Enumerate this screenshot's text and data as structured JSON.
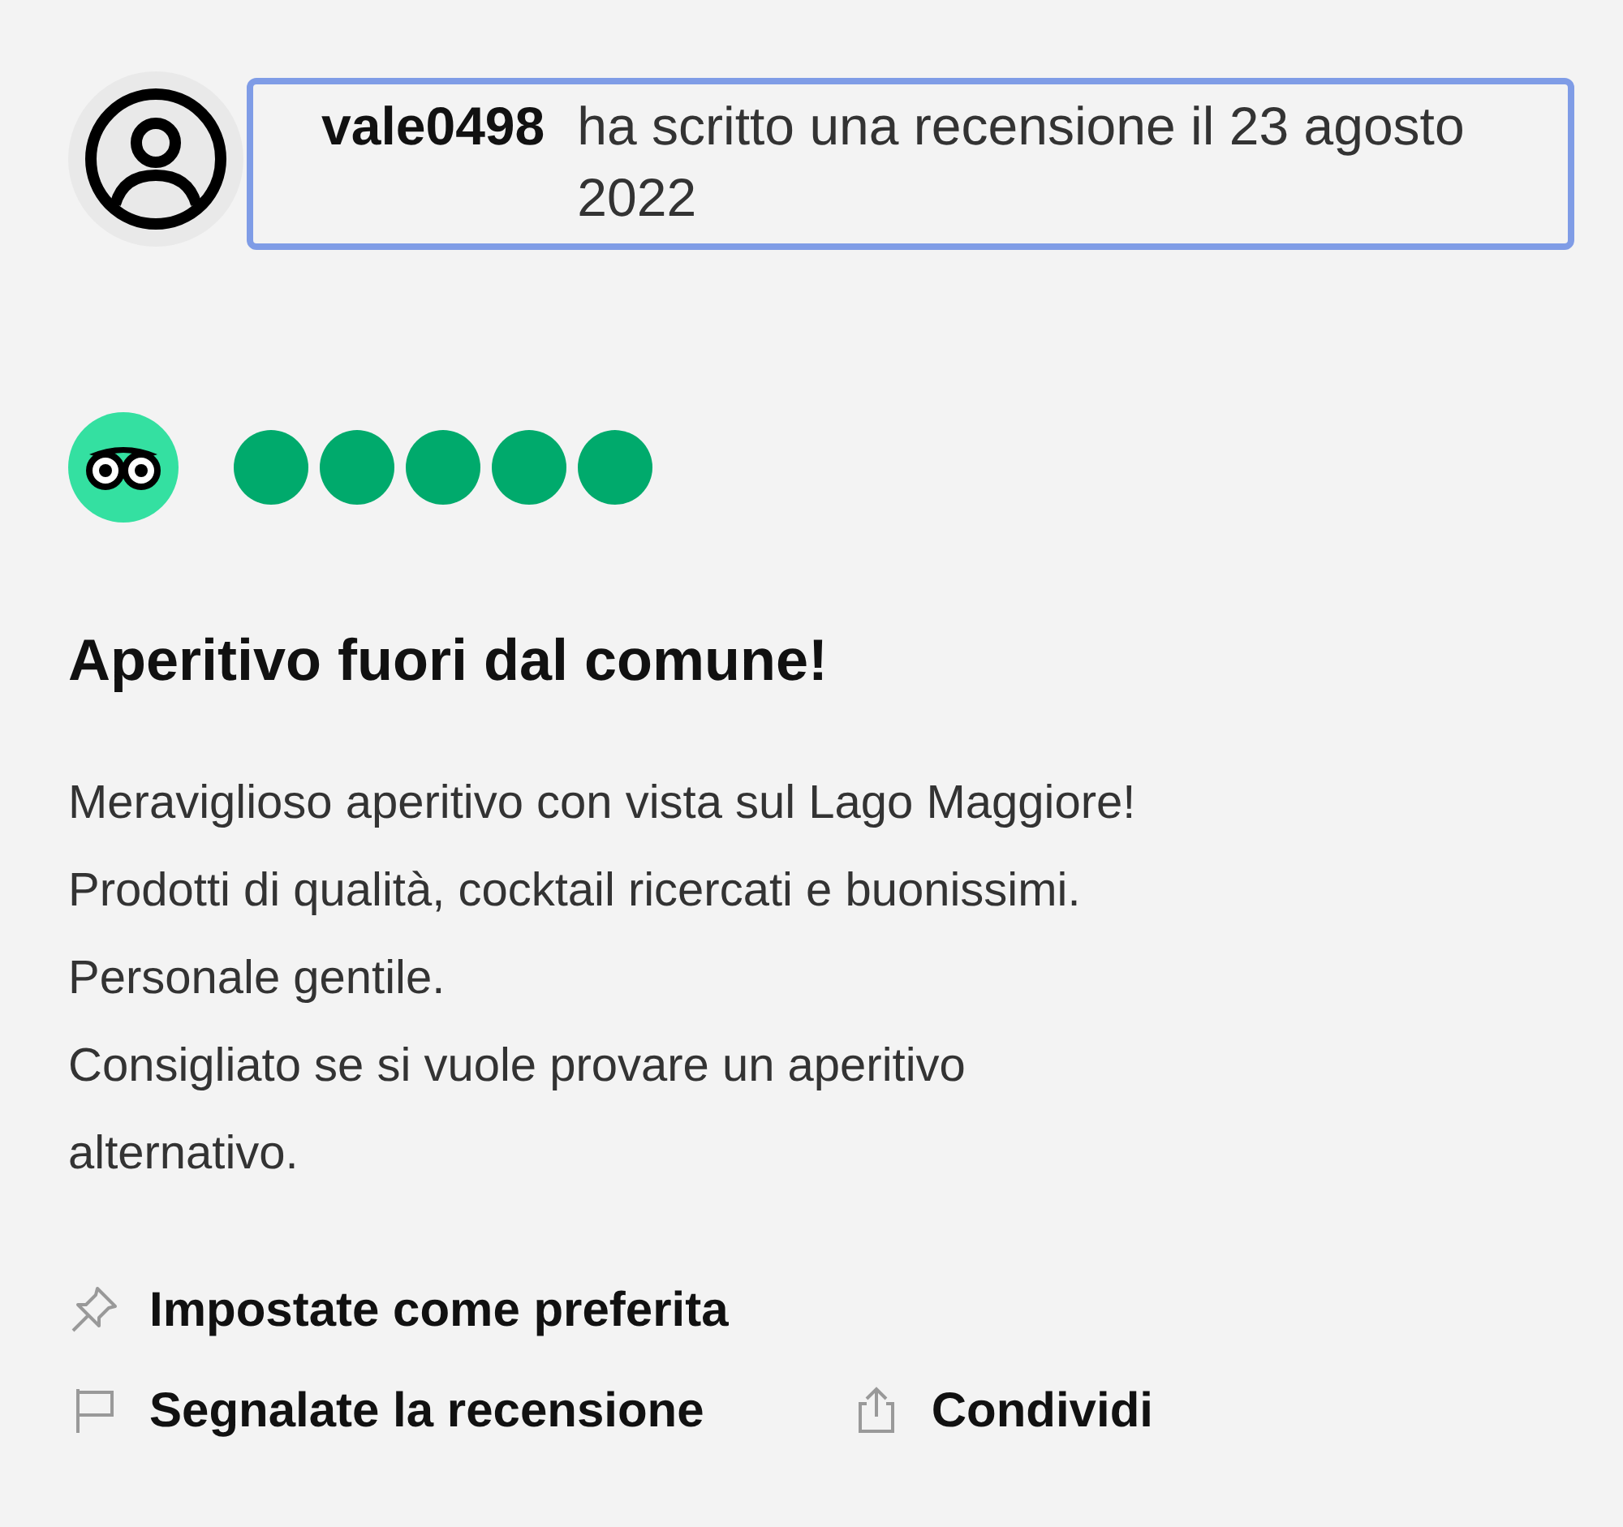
{
  "header": {
    "username": "vale0498",
    "text": "ha scritto una recensione il 23 agosto 2022",
    "highlighted": true
  },
  "rating": {
    "stars": 5
  },
  "review": {
    "title": "Aperitivo fuori dal comune!",
    "paragraphs": [
      "Meraviglioso aperitivo con vista sul Lago Maggiore!",
      "Prodotti di qualità, cocktail ricercati e buonissimi.",
      "Personale gentile.",
      "Consigliato se si vuole provare un aperitivo alternativo."
    ]
  },
  "actions": [
    [
      {
        "kind": "pin",
        "label": "Impostate come preferita"
      }
    ],
    [
      {
        "kind": "flag",
        "label": "Segnalate la recensione"
      },
      {
        "kind": "share",
        "label": "Condividi"
      }
    ]
  ]
}
